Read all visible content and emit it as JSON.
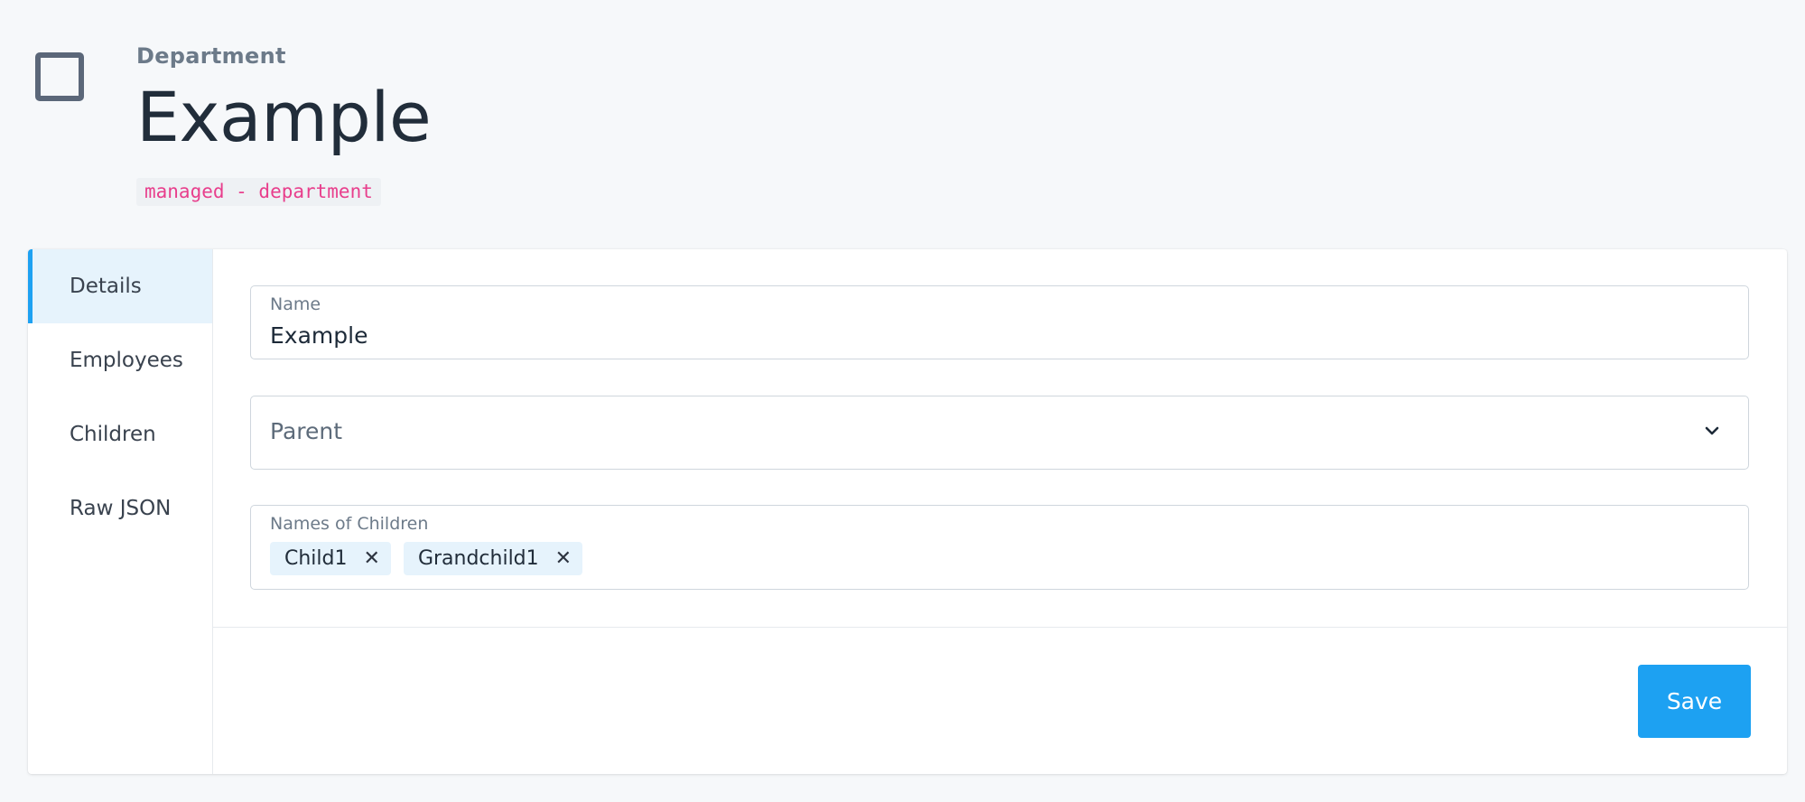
{
  "header": {
    "eyebrow": "Department",
    "title": "Example",
    "subtitle": "managed - department"
  },
  "sidebar": {
    "items": [
      {
        "label": "Details",
        "active": true
      },
      {
        "label": "Employees",
        "active": false
      },
      {
        "label": "Children",
        "active": false
      },
      {
        "label": "Raw JSON",
        "active": false
      }
    ]
  },
  "form": {
    "name": {
      "label": "Name",
      "value": "Example"
    },
    "parent": {
      "placeholder": "Parent"
    },
    "children": {
      "label": "Names of Children",
      "chips": [
        "Child1",
        "Grandchild1"
      ]
    },
    "save_label": "Save"
  },
  "icons": {
    "header": "checkbox-square-icon",
    "dropdown": "chevron-down-icon",
    "remove": "close-icon"
  },
  "colors": {
    "accent": "#1da1f2",
    "code": "#e83e8c",
    "icon": "#5b6779"
  }
}
